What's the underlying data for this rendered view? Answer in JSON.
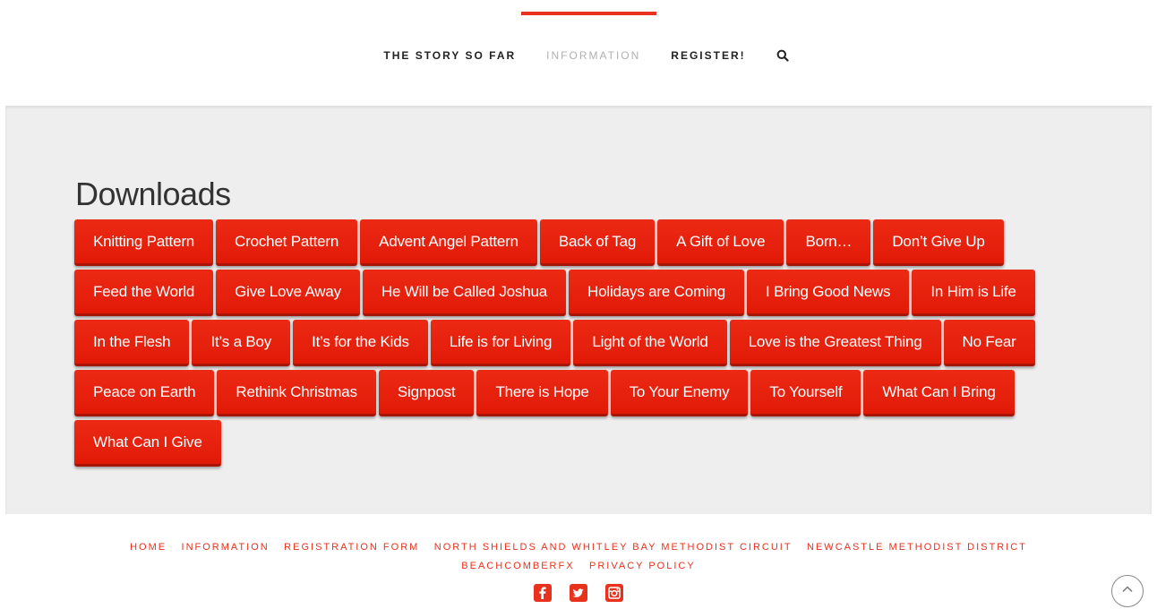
{
  "header": {
    "accent_color": "#e8321e",
    "nav": [
      {
        "label": "THE STORY SO FAR",
        "active": true
      },
      {
        "label": "INFORMATION",
        "active": false
      },
      {
        "label": "REGISTER!",
        "active": true
      }
    ],
    "search_icon": "search-icon"
  },
  "main": {
    "title": "Downloads",
    "button_color": "#e8200e",
    "downloads": [
      "Knitting Pattern",
      "Crochet Pattern",
      "Advent Angel Pattern",
      "Back of Tag",
      "A Gift of Love",
      "Born…",
      "Don’t Give Up",
      "Feed the World",
      "Give Love Away",
      "He Will be Called Joshua",
      "Holidays are Coming",
      "I Bring Good News",
      "In Him is Life",
      "In the Flesh",
      "It’s a Boy",
      "It’s for the Kids",
      "Life is for Living",
      "Light of the World",
      "Love is the Greatest Thing",
      "No Fear",
      "Peace on Earth",
      "Rethink Christmas",
      "Signpost",
      "There is Hope",
      "To Your Enemy",
      "To Yourself",
      "What Can I Bring",
      "What Can I Give"
    ]
  },
  "footer": {
    "link_color": "#e8321e",
    "links": [
      "HOME",
      "INFORMATION",
      "REGISTRATION FORM",
      "NORTH SHIELDS AND WHITLEY BAY METHODIST CIRCUIT",
      "NEWCASTLE METHODIST DISTRICT",
      "BEACHCOMBERFX",
      "PRIVACY POLICY"
    ],
    "social": [
      "facebook-icon",
      "twitter-icon",
      "instagram-icon"
    ],
    "scroll_top_icon": "chevron-up-icon"
  }
}
